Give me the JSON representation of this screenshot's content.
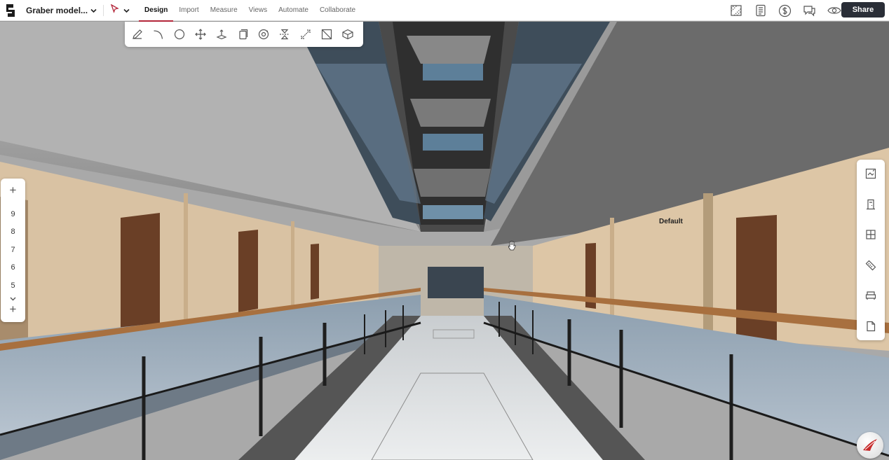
{
  "app": {
    "model_name": "Graber model...",
    "share_label": "Share"
  },
  "tabs": [
    {
      "label": "Design",
      "active": true
    },
    {
      "label": "Import",
      "active": false
    },
    {
      "label": "Measure",
      "active": false
    },
    {
      "label": "Views",
      "active": false
    },
    {
      "label": "Automate",
      "active": false
    },
    {
      "label": "Collaborate",
      "active": false
    }
  ],
  "header_icons": [
    "sheet-icon",
    "schedule-icon",
    "cost-icon",
    "comments-icon",
    "visibility-eye-icon"
  ],
  "draw_tools": [
    "pencil-icon",
    "arc-icon",
    "circle-icon",
    "move-icon",
    "push-pull-icon",
    "copy-icon",
    "rotate-icon",
    "mirror-icon",
    "scale-icon",
    "section-icon",
    "solid-icon"
  ],
  "levels": {
    "items": [
      "9",
      "8",
      "7",
      "6",
      "5"
    ]
  },
  "right_panel_icons": [
    "render-icon",
    "door-icon",
    "window-icon",
    "ruler-icon",
    "furniture-icon",
    "document-icon"
  ],
  "scene": {
    "label": "Default"
  },
  "colors": {
    "accent": "#b3263a",
    "share_bg": "#2a2e37"
  }
}
